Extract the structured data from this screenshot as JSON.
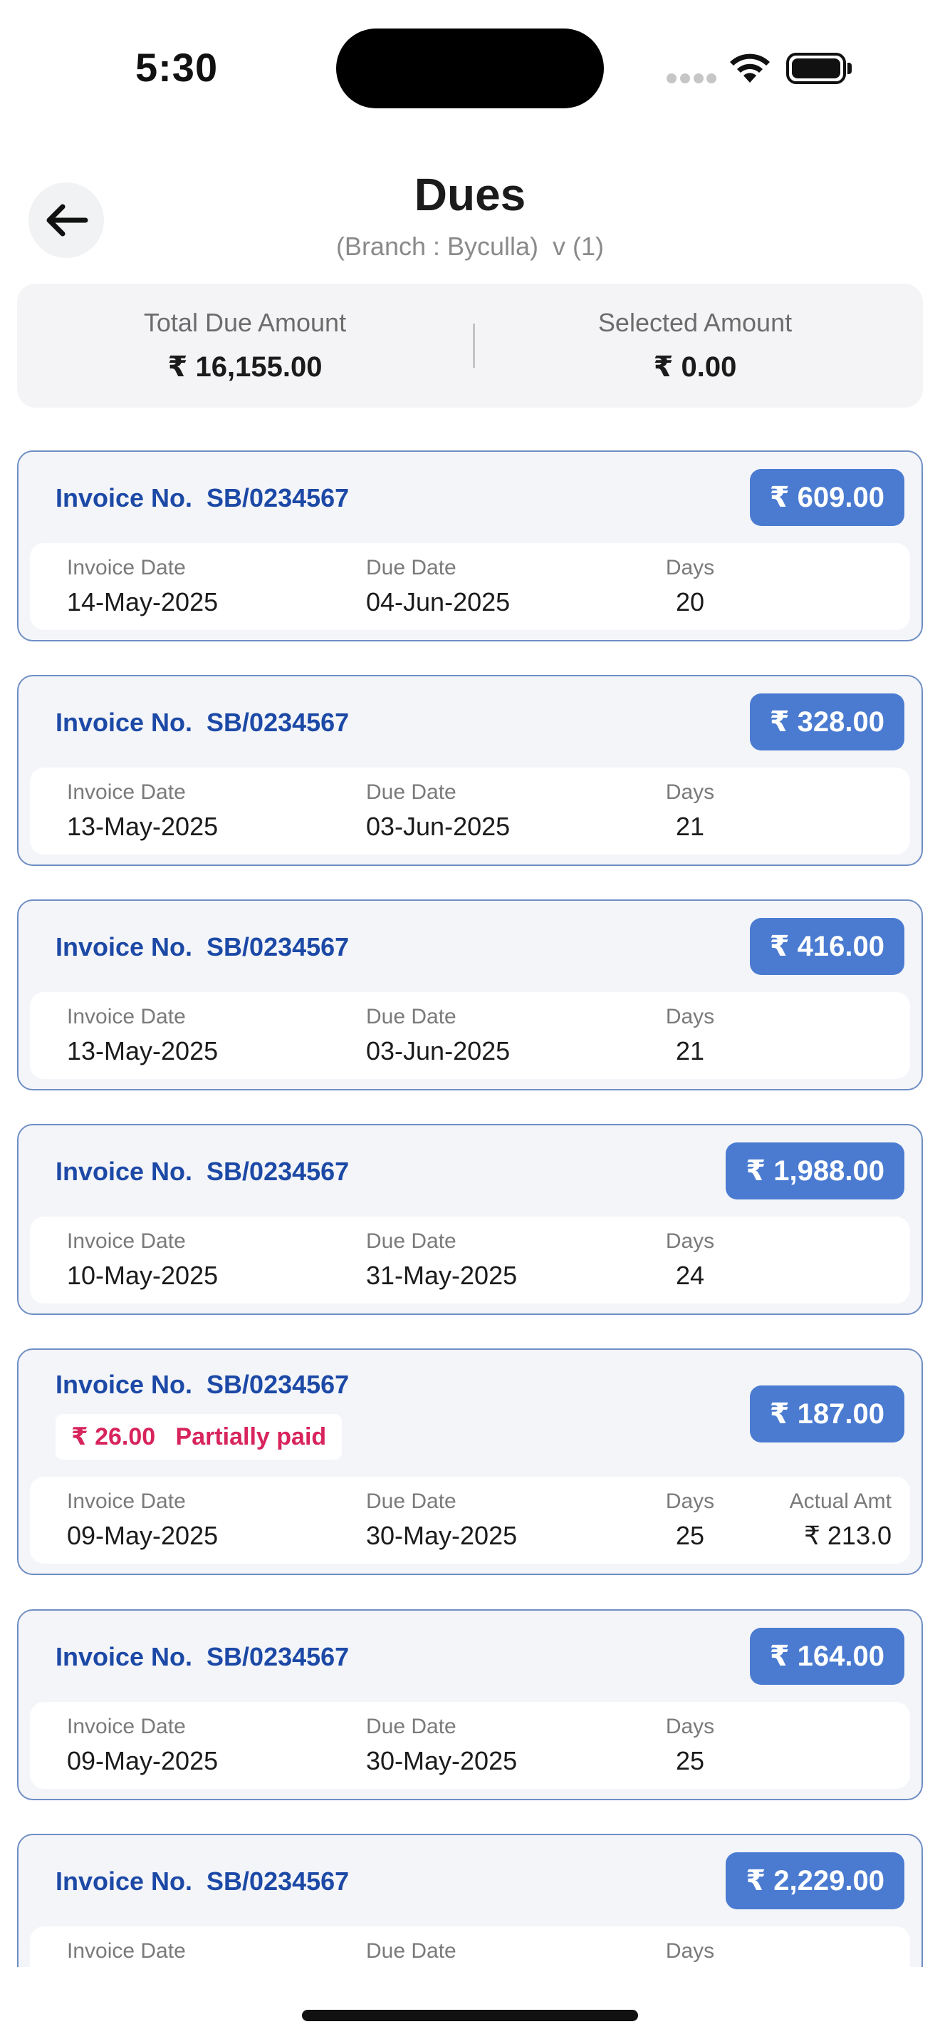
{
  "status_bar": {
    "time": "5:30"
  },
  "header": {
    "title": "Dues",
    "subtitle": "(Branch : Byculla)  v (1)",
    "back_icon": "arrow-left-icon"
  },
  "summary": {
    "total_label": "Total Due Amount",
    "total_value": "₹ 16,155.00",
    "selected_label": "Selected Amount",
    "selected_value": "₹ 0.00"
  },
  "labels": {
    "invoice_date": "Invoice Date",
    "due_date": "Due Date",
    "days": "Days",
    "actual_amt": "Actual Amt"
  },
  "invoices": [
    {
      "invoice_no": "Invoice No.  SB/0234567",
      "amount": "₹ 609.00",
      "invoice_date": "14-May-2025",
      "due_date": "04-Jun-2025",
      "days": "20"
    },
    {
      "invoice_no": "Invoice No.  SB/0234567",
      "amount": "₹ 328.00",
      "invoice_date": "13-May-2025",
      "due_date": "03-Jun-2025",
      "days": "21"
    },
    {
      "invoice_no": "Invoice No.  SB/0234567",
      "amount": "₹ 416.00",
      "invoice_date": "13-May-2025",
      "due_date": "03-Jun-2025",
      "days": "21"
    },
    {
      "invoice_no": "Invoice No.  SB/0234567",
      "amount": "₹ 1,988.00",
      "invoice_date": "10-May-2025",
      "due_date": "31-May-2025",
      "days": "24"
    },
    {
      "invoice_no": "Invoice No.  SB/0234567",
      "amount": "₹ 187.00",
      "partial_text": "₹ 26.00   Partially paid",
      "invoice_date": "09-May-2025",
      "due_date": "30-May-2025",
      "days": "25",
      "actual_amt": "₹ 213.0"
    },
    {
      "invoice_no": "Invoice No.  SB/0234567",
      "amount": "₹ 164.00",
      "invoice_date": "09-May-2025",
      "due_date": "30-May-2025",
      "days": "25"
    },
    {
      "invoice_no": "Invoice No.  SB/0234567",
      "amount": "₹ 2,229.00"
    }
  ],
  "colors": {
    "accent_blue": "#4a7bd1",
    "invoice_text_blue": "#1c49a6",
    "partial_red": "#d8245c",
    "card_border": "#6f8ec4"
  }
}
